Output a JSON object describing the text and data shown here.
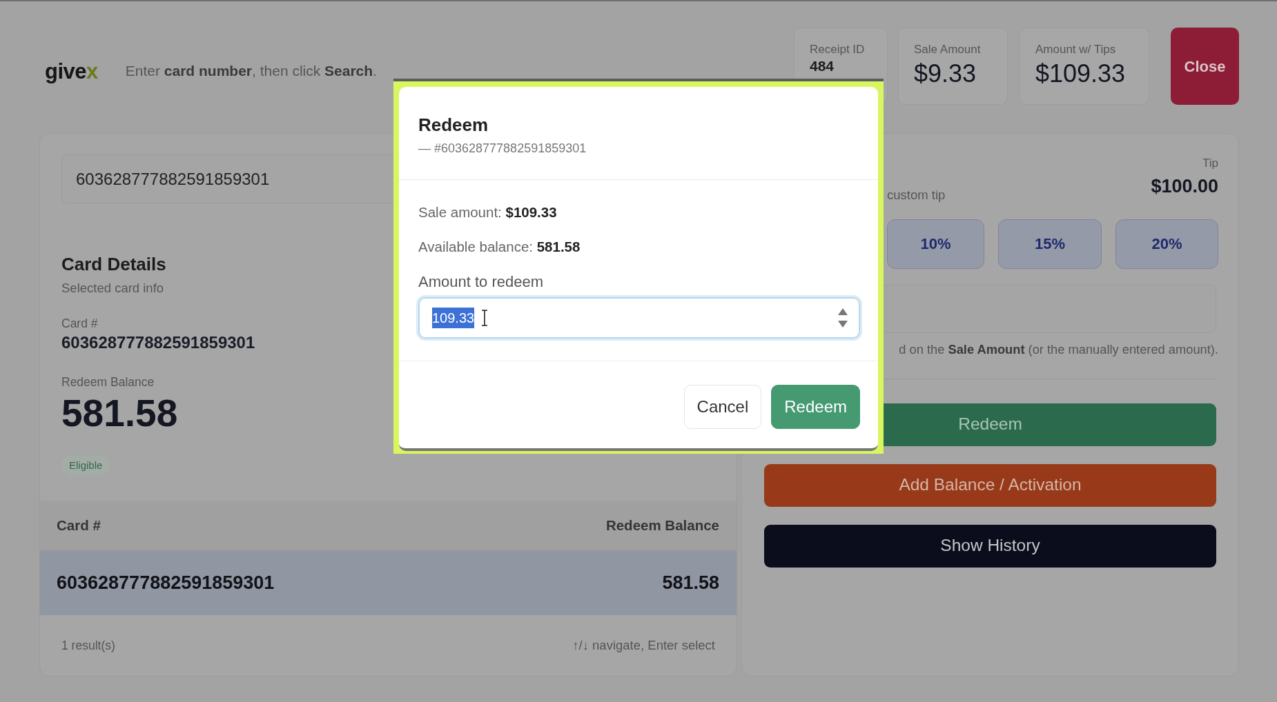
{
  "header": {
    "logo": {
      "main": "give",
      "accent": "x"
    },
    "instruction": "Enter **card number**, then click **Search**."
  },
  "stats": [
    {
      "label": "Receipt ID",
      "value": "484",
      "kind": "small"
    },
    {
      "label": "Sale Amount",
      "value": "$9.33",
      "kind": "large"
    },
    {
      "label": "Amount w/ Tips",
      "value": "$109.33",
      "kind": "large"
    }
  ],
  "close_button": "Close",
  "search": {
    "value": "603628777882591859301"
  },
  "card_details": {
    "title": "Card Details",
    "subtitle": "Selected card info",
    "card_label": "Card #",
    "card_number": "603628777882591859301",
    "balance_label": "Redeem Balance",
    "balance": "581.58",
    "status": "Eligible"
  },
  "results_table": {
    "columns": [
      "Card #",
      "Redeem Balance"
    ],
    "rows": [
      {
        "cells": [
          "603628777882591859301",
          "581.58"
        ],
        "selected": true
      }
    ],
    "footer_left": "1 result(s)",
    "footer_right": "↑/↓ navigate, Enter select"
  },
  "tip_panel": {
    "hint": "custom tip",
    "label": "Tip",
    "amount": "$100.00",
    "presets": [
      {
        "label": "10%",
        "selected": false
      },
      {
        "label": "15%",
        "selected": false
      },
      {
        "label": "20%",
        "selected": false
      }
    ],
    "note": "d on the **Sale Amount** (or the manually entered amount)."
  },
  "actions": [
    {
      "label": "Redeem",
      "kind": "success"
    },
    {
      "label": "Add Balance / Activation",
      "kind": "warning"
    },
    {
      "label": "Show History",
      "kind": "dark"
    }
  ],
  "modal": {
    "title": "Redeem",
    "subtitle": "— #603628777882591859301",
    "lines": [
      "Sale amount: **$109.33**",
      "Available balance: **581.58**"
    ],
    "field_label": "Amount to redeem",
    "field_value": "109.33",
    "value_selected": true,
    "buttons": [
      {
        "label": "Cancel",
        "kind": "secondary"
      },
      {
        "label": "Redeem",
        "kind": "primary"
      }
    ]
  }
}
